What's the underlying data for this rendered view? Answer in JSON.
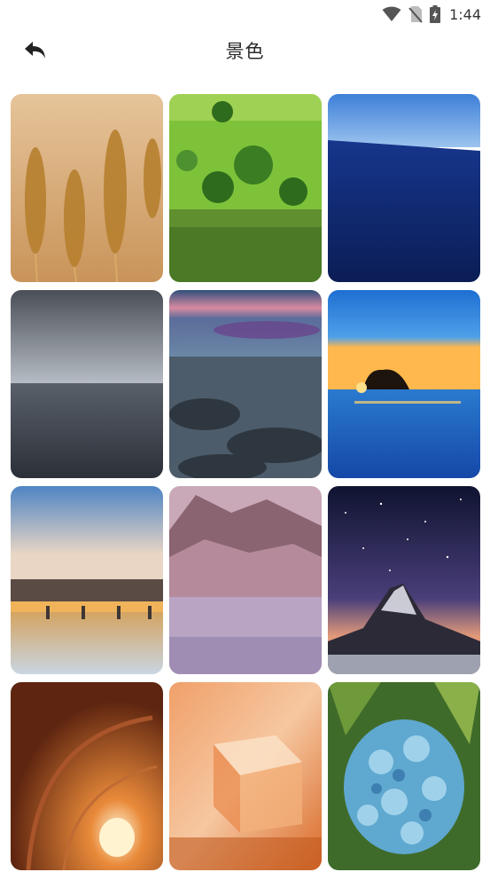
{
  "status_bar": {
    "time": "1:44",
    "icons": [
      "wifi-icon",
      "no-sim-icon",
      "battery-charging-icon"
    ]
  },
  "header": {
    "title": "景色",
    "back_icon": "back-arrow-icon"
  },
  "gallery": {
    "items": [
      {
        "name": "wheat-field"
      },
      {
        "name": "green-hills-lake"
      },
      {
        "name": "deep-blue-sea"
      },
      {
        "name": "grey-sea-clouds"
      },
      {
        "name": "rocky-shore-sunset"
      },
      {
        "name": "sunset-rock-island"
      },
      {
        "name": "city-bridge-river"
      },
      {
        "name": "misty-mountain-lake"
      },
      {
        "name": "starry-mountain-peak"
      },
      {
        "name": "orange-tunnel"
      },
      {
        "name": "glass-cube-abstract"
      },
      {
        "name": "blue-hydrangea"
      }
    ]
  }
}
